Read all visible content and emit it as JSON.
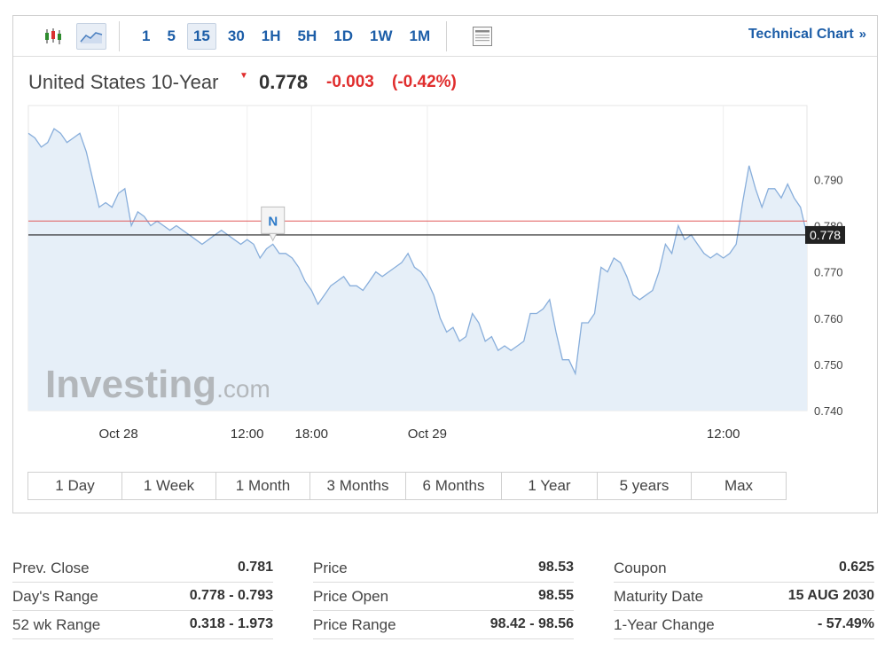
{
  "toolbar": {
    "chart_type_icons": [
      "candlestick-icon",
      "area-chart-icon"
    ],
    "intervals": [
      "1",
      "5",
      "15",
      "30",
      "1H",
      "5H",
      "1D",
      "1W",
      "1M"
    ],
    "active_interval": "15",
    "technical_chart_label": "Technical Chart",
    "technical_chart_arrow": "»"
  },
  "quote": {
    "name": "United States 10-Year",
    "price": "0.778",
    "change": "-0.003",
    "change_pct": "(-0.42%)",
    "direction": "down",
    "down_color": "#e02d2d"
  },
  "chart_data": {
    "type": "area",
    "x": [
      "Oct 28 07:00",
      "07:15",
      "07:30",
      "07:45",
      "08:00",
      "08:15",
      "08:30",
      "08:45",
      "09:00",
      "09:15",
      "09:30",
      "09:45",
      "10:00",
      "10:15",
      "10:30",
      "10:45",
      "11:00",
      "11:15",
      "11:30",
      "11:45",
      "12:00",
      "12:15",
      "12:30",
      "12:45",
      "13:00",
      "13:15",
      "13:30",
      "13:45",
      "14:00",
      "14:15",
      "14:30",
      "14:45",
      "15:00",
      "15:15",
      "15:30",
      "15:45",
      "16:00",
      "16:15",
      "16:30",
      "16:45",
      "17:00",
      "17:15",
      "17:30",
      "17:45",
      "18:00",
      "18:15",
      "18:30",
      "18:45",
      "19:00",
      "19:15",
      "19:30",
      "19:45",
      "20:00",
      "20:15",
      "20:30",
      "20:45",
      "21:00",
      "21:15",
      "21:30",
      "21:45",
      "22:00",
      "22:15",
      "22:30",
      "22:45",
      "23:00",
      "23:15",
      "23:30",
      "23:45",
      "Oct 29 00:00",
      "00:15",
      "00:30",
      "00:45",
      "01:00",
      "01:15",
      "01:30",
      "01:45",
      "02:00",
      "02:15",
      "02:30",
      "02:45",
      "03:00",
      "03:15",
      "03:30",
      "03:45",
      "04:00",
      "04:15",
      "04:30",
      "04:45",
      "05:00",
      "05:15",
      "05:30",
      "05:45",
      "06:00",
      "06:15",
      "06:30",
      "06:45",
      "07:00",
      "07:15",
      "07:30",
      "07:45",
      "08:00",
      "08:15",
      "08:30",
      "08:45",
      "09:00",
      "09:15",
      "09:30",
      "09:45",
      "10:00",
      "10:15",
      "10:30",
      "10:45",
      "11:00",
      "11:15",
      "11:30",
      "11:45",
      "12:00",
      "12:15",
      "12:30",
      "12:45",
      "13:00",
      "13:15",
      "13:30",
      "13:45"
    ],
    "values": [
      0.8,
      0.799,
      0.797,
      0.798,
      0.801,
      0.8,
      0.798,
      0.799,
      0.8,
      0.796,
      0.79,
      0.784,
      0.785,
      0.784,
      0.787,
      0.788,
      0.78,
      0.783,
      0.782,
      0.78,
      0.781,
      0.78,
      0.779,
      0.78,
      0.779,
      0.778,
      0.777,
      0.776,
      0.777,
      0.778,
      0.779,
      0.778,
      0.777,
      0.776,
      0.777,
      0.776,
      0.773,
      0.775,
      0.776,
      0.774,
      0.774,
      0.773,
      0.771,
      0.768,
      0.766,
      0.763,
      0.765,
      0.767,
      0.768,
      0.769,
      0.767,
      0.767,
      0.766,
      0.768,
      0.77,
      0.769,
      0.77,
      0.771,
      0.772,
      0.774,
      0.771,
      0.77,
      0.768,
      0.765,
      0.76,
      0.757,
      0.758,
      0.755,
      0.756,
      0.761,
      0.759,
      0.755,
      0.756,
      0.753,
      0.754,
      0.753,
      0.754,
      0.755,
      0.761,
      0.761,
      0.762,
      0.764,
      0.757,
      0.751,
      0.751,
      0.748,
      0.759,
      0.759,
      0.761,
      0.771,
      0.77,
      0.773,
      0.772,
      0.769,
      0.765,
      0.764,
      0.765,
      0.766,
      0.77,
      0.776,
      0.774,
      0.78,
      0.777,
      0.778,
      0.776,
      0.774,
      0.773,
      0.774,
      0.773,
      0.774,
      0.776,
      0.785,
      0.793,
      0.788,
      0.784,
      0.788,
      0.788,
      0.786,
      0.789,
      0.786,
      0.784,
      0.778
    ],
    "xlabel": "",
    "ylabel": "",
    "ylim": [
      0.74,
      0.806
    ],
    "y_ticks": [
      "0.790",
      "0.780",
      "0.770",
      "0.760",
      "0.750",
      "0.740"
    ],
    "y_tick_values": [
      0.79,
      0.78,
      0.77,
      0.76,
      0.75,
      0.74
    ],
    "x_ticks": [
      "Oct 28",
      "12:00",
      "18:00",
      "Oct 29",
      "12:00"
    ],
    "x_tick_positions": [
      "Oct 28 07:00",
      "12:00",
      "18:00",
      "Oct 29 00:00",
      "12:00"
    ],
    "x_tick_indices": [
      14,
      34,
      44,
      62,
      108
    ],
    "prev_close": 0.781,
    "prev_close_color": "#e05c5c",
    "current_price_label": "0.778",
    "current_price": 0.778,
    "line_color": "#88aedb",
    "fill_color": "#e6eff8",
    "grid": "vertical",
    "news_marker": {
      "label": "N",
      "index": 38
    },
    "watermark_main": "Investing",
    "watermark_suffix": ".com"
  },
  "range_tabs": [
    "1 Day",
    "1 Week",
    "1 Month",
    "3 Months",
    "6 Months",
    "1 Year",
    "5 years",
    "Max"
  ],
  "stats": {
    "col1": [
      {
        "label": "Prev. Close",
        "value": "0.781"
      },
      {
        "label": "Day's Range",
        "value": "0.778 - 0.793"
      },
      {
        "label": "52 wk Range",
        "value": "0.318 - 1.973"
      }
    ],
    "col2": [
      {
        "label": "Price",
        "value": "98.53"
      },
      {
        "label": "Price Open",
        "value": "98.55"
      },
      {
        "label": "Price Range",
        "value": "98.42 - 98.56"
      }
    ],
    "col3": [
      {
        "label": "Coupon",
        "value": "0.625"
      },
      {
        "label": "Maturity Date",
        "value": "15 AUG 2030"
      },
      {
        "label": "1-Year Change",
        "value": "- 57.49%"
      }
    ]
  }
}
